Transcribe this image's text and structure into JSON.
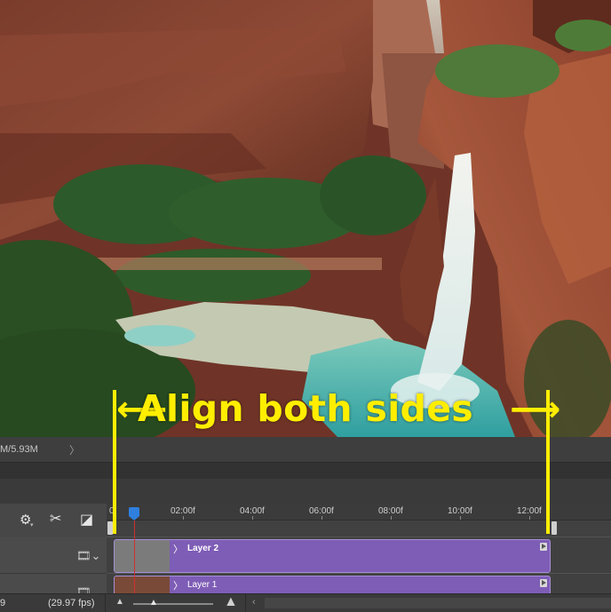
{
  "annotation": {
    "text": "Align both sides",
    "left_arrow": "⟵",
    "right_arrow": "⟶"
  },
  "status_bar": {
    "doc_size": "M/5.93M",
    "chevron": "〉"
  },
  "timeline": {
    "ruler_labels": [
      "0",
      "02:00f",
      "04:00f",
      "06:00f",
      "08:00f",
      "10:00f",
      "12:00f"
    ],
    "layers": [
      {
        "name": "Layer 2",
        "caret": "〉"
      },
      {
        "name": "Layer 1",
        "caret": "〉"
      }
    ],
    "film_icon": "🎞⌄",
    "settings_icon": "⚙",
    "cut_icon": "✂",
    "transition_icon": "◪"
  },
  "footer": {
    "frame_number": "9",
    "fps": "(29.97 fps)"
  },
  "colors": {
    "annotation": "#ffee00",
    "clip": "#7e5db6",
    "playhead": "#2f7fde",
    "playhead_line": "#d03030"
  }
}
